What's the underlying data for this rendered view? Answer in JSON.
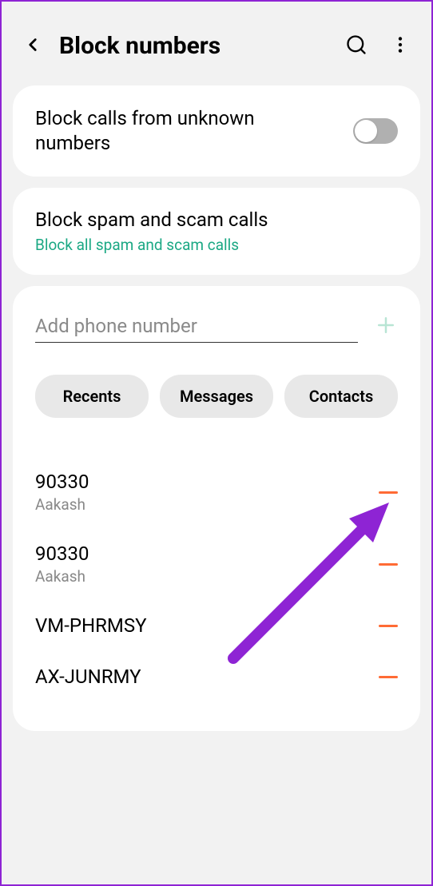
{
  "header": {
    "title": "Block numbers"
  },
  "unknown_card": {
    "label": "Block calls from unknown numbers"
  },
  "spam_card": {
    "title": "Block spam and scam calls",
    "subtitle": "Block all spam and scam calls"
  },
  "input": {
    "placeholder": "Add phone number"
  },
  "chips": {
    "recents": "Recents",
    "messages": "Messages",
    "contacts": "Contacts"
  },
  "blocked": [
    {
      "number": "90330",
      "name": "Aakash"
    },
    {
      "number": "90330",
      "name": "Aakash"
    },
    {
      "number": "VM-PHRMSY",
      "name": ""
    },
    {
      "number": "AX-JUNRMY",
      "name": ""
    }
  ]
}
